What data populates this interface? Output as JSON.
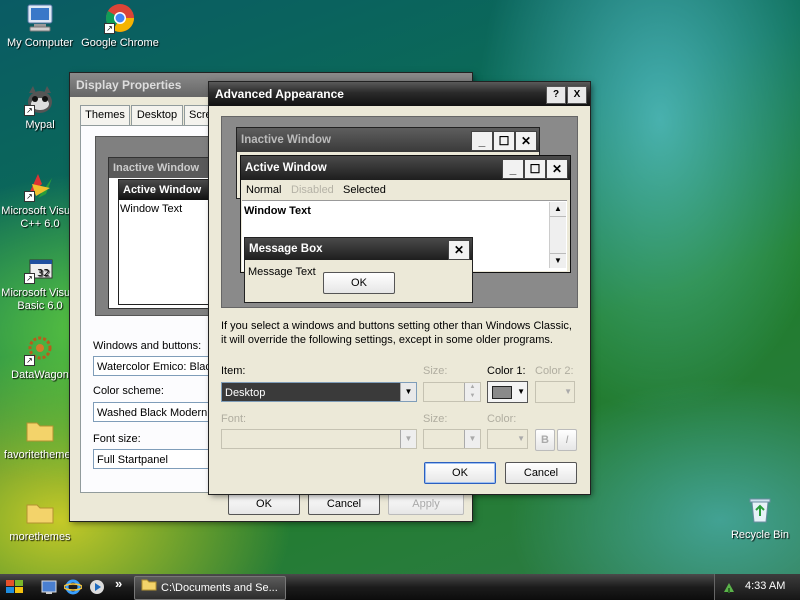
{
  "desktop": {
    "icons": [
      {
        "label": "My Computer",
        "icon": "computer-icon"
      },
      {
        "label": "Google Chrome",
        "icon": "chrome-icon"
      },
      {
        "label": "Mypal",
        "icon": "mypal-icon"
      },
      {
        "label": "Microsoft Visual C++ 6.0",
        "icon": "visual-cpp-icon"
      },
      {
        "label": "Microsoft Visual Basic 6.0",
        "icon": "visual-basic-icon"
      },
      {
        "label": "DataWagon",
        "icon": "datawagon-icon"
      },
      {
        "label": "favoritethemes",
        "icon": "folder-icon"
      },
      {
        "label": "morethemes",
        "icon": "folder-icon"
      },
      {
        "label": "Recycle Bin",
        "icon": "recycle-bin-icon"
      }
    ]
  },
  "display_properties": {
    "title": "Display Properties",
    "tabs": [
      "Themes",
      "Desktop",
      "Scre"
    ],
    "preview": {
      "inactive": "Inactive Window",
      "active": "Active Window",
      "text": "Window Text"
    },
    "windows_buttons_label": "Windows and buttons:",
    "windows_buttons_value": "Watercolor Emico: Blac",
    "color_scheme_label": "Color scheme:",
    "color_scheme_value": "Washed Black Modern",
    "font_size_label": "Font size:",
    "font_size_value": "Full Startpanel",
    "ok": "OK",
    "cancel": "Cancel",
    "apply": "Apply"
  },
  "advanced": {
    "title": "Advanced Appearance",
    "help": "?",
    "close": "X",
    "preview": {
      "inactive": "Inactive Window",
      "active": "Active Window",
      "menu": [
        "Normal",
        "Disabled",
        "Selected"
      ],
      "window_text": "Window Text",
      "msgbox_title": "Message Box",
      "msgbox_text": "Message Text",
      "msgbox_ok": "OK"
    },
    "info_text_1": "If you select a windows and buttons setting other than Windows Classic,",
    "info_text_2": "it will override the following settings, except in some older programs.",
    "item_label": "Item:",
    "item_value": "Desktop",
    "size_label": "Size:",
    "color1_label": "Color 1:",
    "color1_value": "#8a8a8a",
    "color2_label": "Color 2:",
    "font_label": "Font:",
    "font_size_label": "Size:",
    "font_color_label": "Color:",
    "bold": "B",
    "italic": "I",
    "ok": "OK",
    "cancel": "Cancel"
  },
  "taskbar": {
    "task_label": "C:\\Documents and Se...",
    "chevron": "»",
    "clock": "4:33 AM"
  }
}
